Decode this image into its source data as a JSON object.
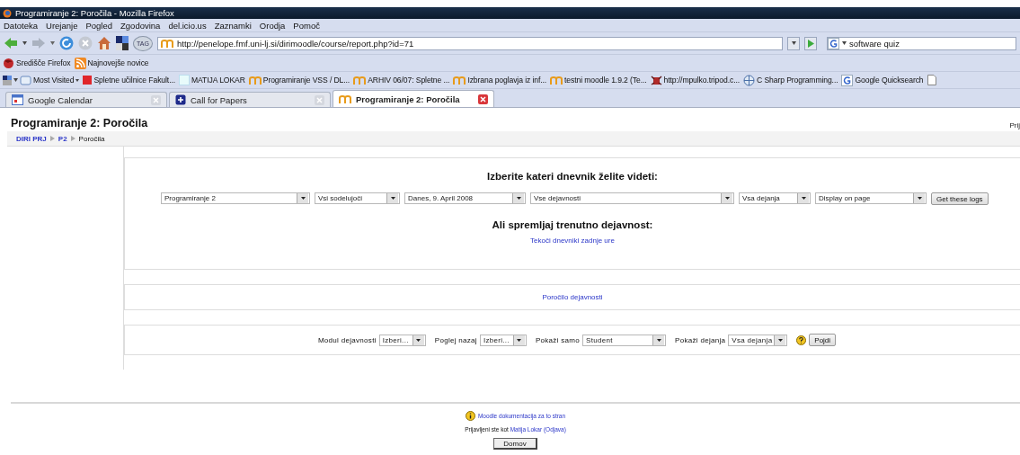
{
  "window": {
    "title": "Programiranje 2: Poročila - Mozilla Firefox"
  },
  "menu": [
    "Datoteka",
    "Urejanje",
    "Pogled",
    "Zgodovina",
    "del.icio.us",
    "Zaznamki",
    "Orodja",
    "Pomoč"
  ],
  "navigation": {
    "tag_button": "TAG",
    "address": "http://penelope.fmf.uni-lj.si/dirimoodle/course/report.php?id=71",
    "search": "software quiz"
  },
  "bookmarks_toolbar": [
    {
      "label": "Središče Firefox",
      "kind": "firefox"
    },
    {
      "label": "Najnovejše novice",
      "kind": "rss"
    }
  ],
  "bookmarks": [
    {
      "label": "Most Visited",
      "kind": "folder"
    },
    {
      "label": "Spletne učilnice Fakult...",
      "kind": "square"
    },
    {
      "label": "MATIJA LOKAR",
      "kind": "blank"
    },
    {
      "label": "Programiranje VSS / DL...",
      "kind": "moodle"
    },
    {
      "label": "ARHIV 06/07: Spletne ...",
      "kind": "moodle"
    },
    {
      "label": "Izbrana poglavja iz inf...",
      "kind": "moodle"
    },
    {
      "label": "testni moodle 1.9.2 (Te...",
      "kind": "moodle"
    },
    {
      "label": "http://mpulko.tripod.c...",
      "kind": "bug"
    },
    {
      "label": "C Sharp Programming...",
      "kind": "globe"
    },
    {
      "label": "Google Quicksearch",
      "kind": "google"
    }
  ],
  "tabs": [
    {
      "label": "Google Calendar",
      "selected": false,
      "kind": "calendar"
    },
    {
      "label": "Call for Papers",
      "selected": false,
      "kind": "plus"
    },
    {
      "label": "Programiranje 2: Poročila",
      "selected": true,
      "kind": "moodle"
    }
  ],
  "page": {
    "heading": "Programiranje 2: Poročila",
    "login_cut": "Prij",
    "breadcrumb": [
      {
        "label": "DIRI PRJ",
        "link": true
      },
      {
        "label": "P2",
        "link": true
      },
      {
        "label": "Poročila",
        "link": false
      }
    ]
  },
  "logs": {
    "heading": "Izberite kateri dnevnik želite videti:",
    "selects": [
      "Programiranje 2",
      "Vsi sodelujoči",
      "Danes, 9. April 2008",
      "Vse dejavnosti",
      "Vsa dejanja",
      "Display on page"
    ],
    "button": "Get these logs",
    "live_heading": "Ali spremljaj trenutno dejavnost:",
    "live_link": "Tekoči dnevniki zadnje ure"
  },
  "activity_report": {
    "link": "Poročilo dejavnosti"
  },
  "filters": {
    "fields": [
      {
        "label": "Modul dejavnosti",
        "value": "Izberi..."
      },
      {
        "label": "Poglej nazaj",
        "value": "Izberi..."
      },
      {
        "label": "Pokaži samo",
        "value": "Student"
      },
      {
        "label": "Pokaži dejanja",
        "value": "Vsa dejanja"
      }
    ],
    "button": "Pojdi"
  },
  "footer": {
    "docs_link": "Moodle dokumentacija za to stran",
    "logged_in_text": "Prijavljeni ste kot",
    "user_link": "Matija Lokar",
    "logout_link": "(Odjava)",
    "home_button": "Domov"
  }
}
